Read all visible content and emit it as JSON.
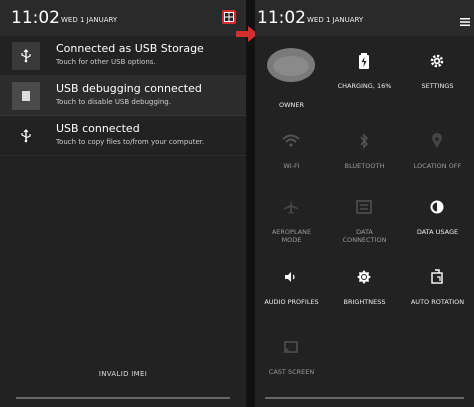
{
  "left_phone": {
    "time": "11:02",
    "date": "WED 1 JANUARY",
    "notifications": [
      {
        "title": "Connected as USB Storage",
        "subtitle": "Touch for other USB options."
      },
      {
        "title": "USB debugging connected",
        "subtitle": "Touch to disable USB debugging."
      },
      {
        "title": "USB connected",
        "subtitle": "Touch to copy files to/from your computer."
      }
    ],
    "footer": "INVALID IMEI"
  },
  "right_phone": {
    "time": "11:02",
    "date": "WED 1 JANUARY",
    "tiles": [
      {
        "label": "OWNER",
        "icon": "owner-avatar-icon"
      },
      {
        "label": "CHARGING, 16%",
        "icon": "battery-charging-icon"
      },
      {
        "label": "SETTINGS",
        "icon": "gear-icon"
      },
      {
        "label": "WI-FI",
        "icon": "wifi-icon"
      },
      {
        "label": "BLUETOOTH",
        "icon": "bluetooth-icon"
      },
      {
        "label": "LOCATION OFF",
        "icon": "location-icon"
      },
      {
        "label": "AEROPLANE\nMODE",
        "icon": "airplane-icon"
      },
      {
        "label": "DATA\nCONNECTION",
        "icon": "data-connection-icon"
      },
      {
        "label": "DATA USAGE",
        "icon": "data-usage-icon"
      },
      {
        "label": "AUDIO PROFILES",
        "icon": "audio-profiles-icon"
      },
      {
        "label": "BRIGHTNESS",
        "icon": "brightness-icon"
      },
      {
        "label": "AUTO ROTATION",
        "icon": "auto-rotation-icon"
      },
      {
        "label": "CAST SCREEN",
        "icon": "cast-screen-icon"
      }
    ]
  },
  "colors": {
    "highlight": "#d32f2f",
    "panel": "#222222",
    "topbar": "#2a2a2a"
  }
}
